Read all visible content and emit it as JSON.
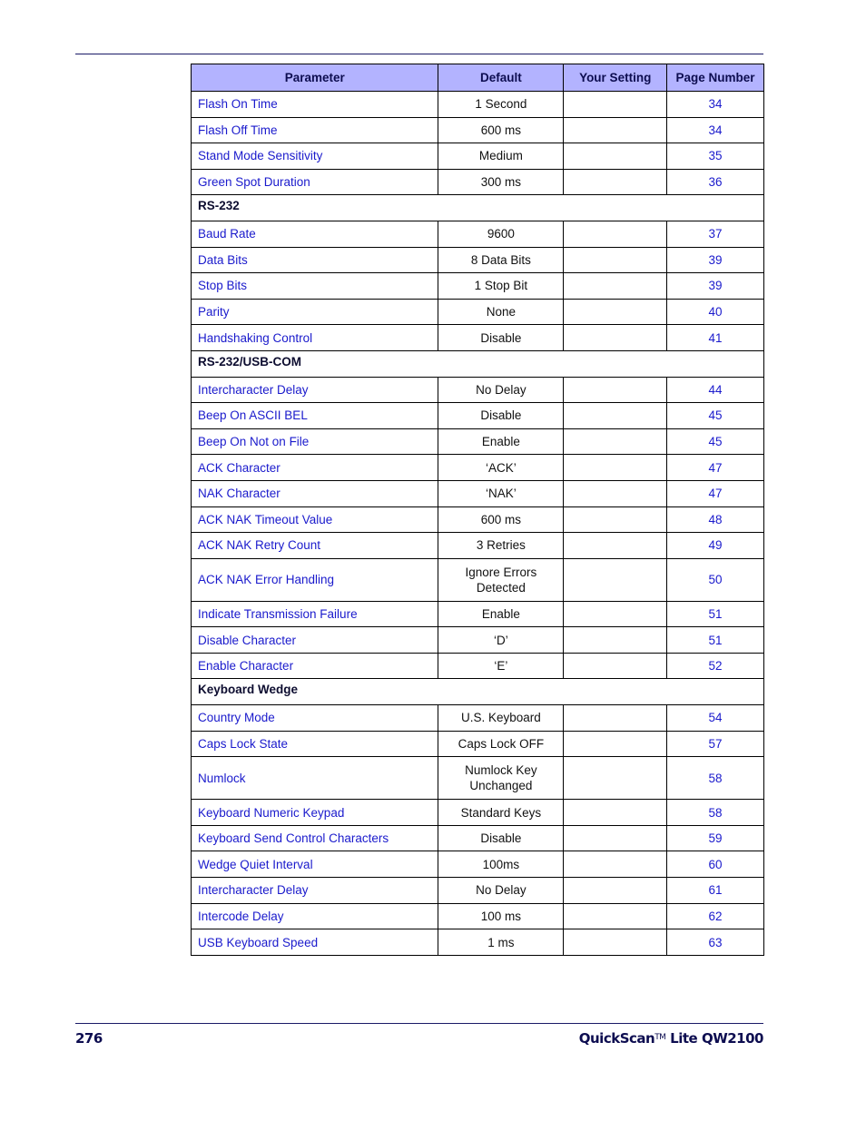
{
  "header": {
    "columns": [
      "Parameter",
      "Default",
      "Your Setting",
      "Page Number"
    ]
  },
  "rows": [
    {
      "type": "row",
      "parameter": "Flash On Time",
      "default": "1 Second",
      "setting": "",
      "page": "34"
    },
    {
      "type": "row",
      "parameter": "Flash Off Time",
      "default": "600 ms",
      "setting": "",
      "page": "34"
    },
    {
      "type": "row",
      "parameter": "Stand Mode Sensitivity",
      "default": "Medium",
      "setting": "",
      "page": "35"
    },
    {
      "type": "row",
      "parameter": "Green Spot Duration",
      "default": "300 ms",
      "setting": "",
      "page": "36"
    },
    {
      "type": "section",
      "title": "RS-232"
    },
    {
      "type": "row",
      "parameter": "Baud Rate",
      "default": "9600",
      "setting": "",
      "page": "37"
    },
    {
      "type": "row",
      "parameter": "Data Bits",
      "default": "8 Data Bits",
      "setting": "",
      "page": "39"
    },
    {
      "type": "row",
      "parameter": "Stop Bits",
      "default": "1 Stop Bit",
      "setting": "",
      "page": "39"
    },
    {
      "type": "row",
      "parameter": "Parity",
      "default": "None",
      "setting": "",
      "page": "40"
    },
    {
      "type": "row",
      "parameter": "Handshaking Control",
      "default": "Disable",
      "setting": "",
      "page": "41"
    },
    {
      "type": "section",
      "title": "RS-232/USB-COM"
    },
    {
      "type": "row",
      "parameter": "Intercharacter Delay",
      "default": "No Delay",
      "setting": "",
      "page": "44"
    },
    {
      "type": "row",
      "parameter": "Beep On ASCII BEL",
      "default": "Disable",
      "setting": "",
      "page": "45"
    },
    {
      "type": "row",
      "parameter": "Beep On Not on File",
      "default": "Enable",
      "setting": "",
      "page": "45"
    },
    {
      "type": "row",
      "parameter": "ACK Character",
      "default": "‘ACK’",
      "setting": "",
      "page": "47"
    },
    {
      "type": "row",
      "parameter": "NAK Character",
      "default": "‘NAK’",
      "setting": "",
      "page": "47"
    },
    {
      "type": "row",
      "parameter": "ACK NAK Timeout Value",
      "default": "600 ms",
      "setting": "",
      "page": "48"
    },
    {
      "type": "row",
      "parameter": "ACK NAK Retry Count",
      "default": "3 Retries",
      "setting": "",
      "page": "49"
    },
    {
      "type": "row",
      "tall": true,
      "parameter": "ACK NAK Error Handling",
      "default": "Ignore Errors\nDetected",
      "setting": "",
      "page": "50"
    },
    {
      "type": "row",
      "parameter": "Indicate Transmission Failure",
      "default": "Enable",
      "setting": "",
      "page": "51"
    },
    {
      "type": "row",
      "parameter": "Disable Character",
      "default": "‘D’",
      "setting": "",
      "page": "51"
    },
    {
      "type": "row",
      "parameter": "Enable Character",
      "default": "‘E’",
      "setting": "",
      "page": "52"
    },
    {
      "type": "section",
      "title": "Keyboard Wedge"
    },
    {
      "type": "row",
      "parameter": "Country Mode",
      "default": "U.S. Keyboard",
      "setting": "",
      "page": "54"
    },
    {
      "type": "row",
      "parameter": "Caps Lock State",
      "default": "Caps Lock OFF",
      "setting": "",
      "page": "57"
    },
    {
      "type": "row",
      "tall": true,
      "parameter": "Numlock",
      "default": "Numlock Key\nUnchanged",
      "setting": "",
      "page": "58"
    },
    {
      "type": "row",
      "parameter": "Keyboard Numeric Keypad",
      "default": "Standard Keys",
      "setting": "",
      "page": "58"
    },
    {
      "type": "row",
      "parameter": "Keyboard Send Control Characters",
      "default": "Disable",
      "setting": "",
      "page": "59"
    },
    {
      "type": "row",
      "parameter": "Wedge Quiet Interval",
      "default": "100ms",
      "setting": "",
      "page": "60"
    },
    {
      "type": "row",
      "parameter": "Intercharacter Delay",
      "default": "No Delay",
      "setting": "",
      "page": "61"
    },
    {
      "type": "row",
      "parameter": "Intercode Delay",
      "default": "100 ms",
      "setting": "",
      "page": "62"
    },
    {
      "type": "row",
      "parameter": "USB Keyboard Speed",
      "default": "1 ms",
      "setting": "",
      "page": "63"
    }
  ],
  "footer": {
    "page_number": "276",
    "product_name": "QuickScan",
    "trademark": "TM",
    "product_model": " Lite QW2100"
  }
}
